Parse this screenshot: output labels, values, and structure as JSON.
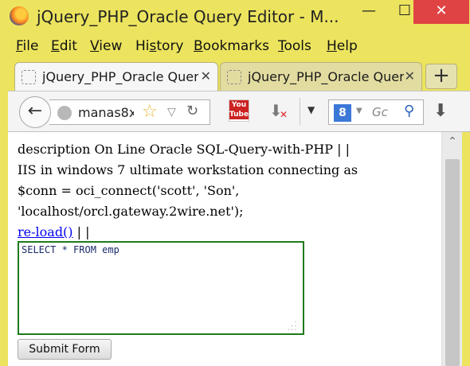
{
  "window": {
    "title": "jQuery_PHP_Oracle Query Editor - M...",
    "minimize_glyph": "—",
    "maximize_glyph": "☐",
    "close_glyph": "✕"
  },
  "menubar": {
    "items": [
      {
        "label": "File",
        "mnemonic": "F",
        "rest": "ile"
      },
      {
        "label": "Edit",
        "mnemonic": "E",
        "rest": "dit"
      },
      {
        "label": "View",
        "mnemonic": "V",
        "rest": "iew"
      },
      {
        "label": "History",
        "mnemonic": "s",
        "prefix": "Hi",
        "rest": "tory"
      },
      {
        "label": "Bookmarks",
        "mnemonic": "B",
        "rest": "ookmarks"
      },
      {
        "label": "Tools",
        "mnemonic": "T",
        "rest": "ools"
      },
      {
        "label": "Help",
        "mnemonic": "H",
        "rest": "elp"
      }
    ]
  },
  "tabs": [
    {
      "label": "jQuery_PHP_Oracle Query Editor",
      "close": "✕"
    },
    {
      "label": "jQuery_PHP_Oracle Query Editor",
      "close": "✕"
    }
  ],
  "newtab_glyph": "+",
  "nav": {
    "back_glyph": "←",
    "url": "manas8x.",
    "search_engine_glyph": "8",
    "search_placeholder": "Gc",
    "youtube_top": "You",
    "youtube_bottom": "Tube"
  },
  "content": {
    "line1": "description On Line Oracle SQL-Query-with-PHP | |",
    "line2": "IIS in windows 7 ultimate workstation connecting as",
    "line3": "$conn = oci_connect('scott', 'Son',",
    "line4": "'localhost/orcl.gateway.2wire.net');",
    "reload_link": "re-load()",
    "reload_suffix": " | |",
    "query": "SELECT * FROM emp",
    "submit_label": "Submit Form"
  },
  "colors": {
    "chrome": "#ece45e",
    "close_button": "#e04343",
    "textarea_border": "#1d7a1d",
    "link": "#0000ee"
  }
}
